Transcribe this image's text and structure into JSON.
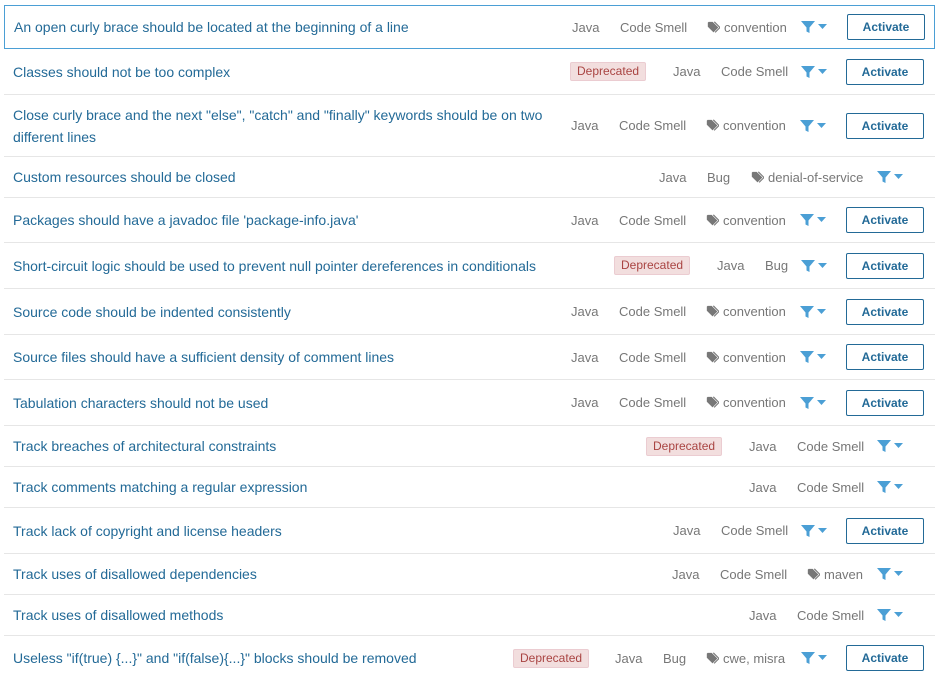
{
  "rules": [
    {
      "title": "An open curly brace should be located at the beginning of a line",
      "deprecated": null,
      "lang": "Java",
      "type": "Code Smell",
      "tags": "convention",
      "activate": "Activate"
    },
    {
      "title": "Classes should not be too complex",
      "deprecated": "Deprecated",
      "lang": "Java",
      "type": "Code Smell",
      "tags": null,
      "activate": "Activate"
    },
    {
      "title": "Close curly brace and the next \"else\", \"catch\" and \"finally\" keywords should be on two different lines",
      "deprecated": null,
      "lang": "Java",
      "type": "Code Smell",
      "tags": "convention",
      "activate": "Activate"
    },
    {
      "title": "Custom resources should be closed",
      "deprecated": null,
      "lang": "Java",
      "type": "Bug",
      "tags": "denial-of-service",
      "activate": null
    },
    {
      "title": "Packages should have a javadoc file 'package-info.java'",
      "deprecated": null,
      "lang": "Java",
      "type": "Code Smell",
      "tags": "convention",
      "activate": "Activate"
    },
    {
      "title": "Short-circuit logic should be used to prevent null pointer dereferences in conditionals",
      "deprecated": "Deprecated",
      "lang": "Java",
      "type": "Bug",
      "tags": null,
      "activate": "Activate"
    },
    {
      "title": "Source code should be indented consistently",
      "deprecated": null,
      "lang": "Java",
      "type": "Code Smell",
      "tags": "convention",
      "activate": "Activate"
    },
    {
      "title": "Source files should have a sufficient density of comment lines",
      "deprecated": null,
      "lang": "Java",
      "type": "Code Smell",
      "tags": "convention",
      "activate": "Activate"
    },
    {
      "title": "Tabulation characters should not be used",
      "deprecated": null,
      "lang": "Java",
      "type": "Code Smell",
      "tags": "convention",
      "activate": "Activate"
    },
    {
      "title": "Track breaches of architectural constraints",
      "deprecated": "Deprecated",
      "lang": "Java",
      "type": "Code Smell",
      "tags": null,
      "activate": null
    },
    {
      "title": "Track comments matching a regular expression",
      "deprecated": null,
      "lang": "Java",
      "type": "Code Smell",
      "tags": null,
      "activate": null
    },
    {
      "title": "Track lack of copyright and license headers",
      "deprecated": null,
      "lang": "Java",
      "type": "Code Smell",
      "tags": null,
      "activate": "Activate"
    },
    {
      "title": "Track uses of disallowed dependencies",
      "deprecated": null,
      "lang": "Java",
      "type": "Code Smell",
      "tags": "maven",
      "activate": null
    },
    {
      "title": "Track uses of disallowed methods",
      "deprecated": null,
      "lang": "Java",
      "type": "Code Smell",
      "tags": null,
      "activate": null
    },
    {
      "title": "Useless \"if(true) {...}\" and \"if(false){...}\" blocks should be removed",
      "deprecated": "Deprecated",
      "lang": "Java",
      "type": "Bug",
      "tags": "cwe, misra",
      "activate": "Activate"
    }
  ],
  "colors": {
    "link": "#236a97",
    "muted": "#777777",
    "filter_icon": "#4b9fd5",
    "selected_border": "#4b9fd5",
    "deprecated_bg": "#f2dede",
    "deprecated_text": "#a94442"
  },
  "icons": {
    "tag": "tag-icon",
    "filter": "filter-icon",
    "dropdown": "caret-down-icon"
  }
}
